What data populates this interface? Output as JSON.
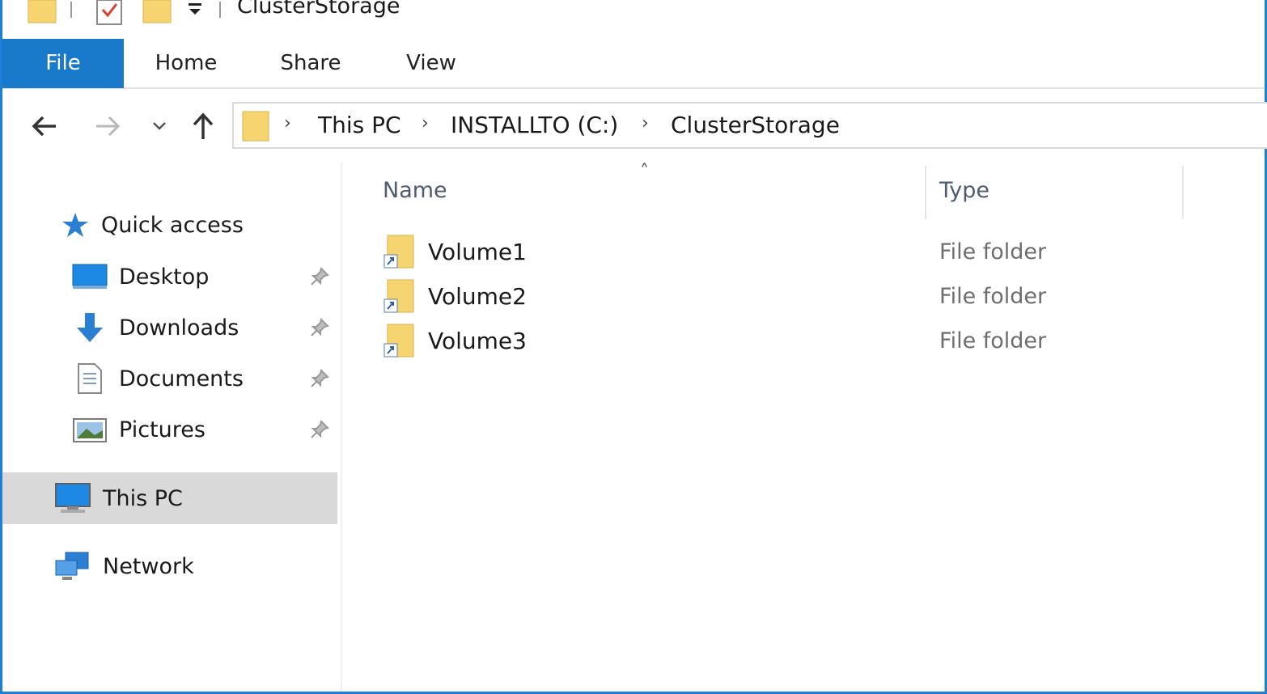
{
  "window": {
    "title": "ClusterStorage"
  },
  "ribbon": {
    "tabs": [
      "File",
      "Home",
      "Share",
      "View"
    ]
  },
  "address": {
    "crumbs": [
      "This PC",
      "INSTALLTO (C:)",
      "ClusterStorage"
    ]
  },
  "nav": {
    "quick_access": "Quick access",
    "items": [
      {
        "label": "Desktop",
        "icon": "desktop-icon"
      },
      {
        "label": "Downloads",
        "icon": "download-arrow-icon"
      },
      {
        "label": "Documents",
        "icon": "document-icon"
      },
      {
        "label": "Pictures",
        "icon": "pictures-icon"
      }
    ],
    "this_pc": "This PC",
    "network": "Network"
  },
  "content": {
    "columns": {
      "name": "Name",
      "type": "Type"
    },
    "files": [
      {
        "name": "Volume1",
        "type": "File folder"
      },
      {
        "name": "Volume2",
        "type": "File folder"
      },
      {
        "name": "Volume3",
        "type": "File folder"
      }
    ]
  },
  "colors": {
    "accent": "#1979ca",
    "folder": "#f6d571",
    "selected_bg": "#d9d9d9"
  }
}
